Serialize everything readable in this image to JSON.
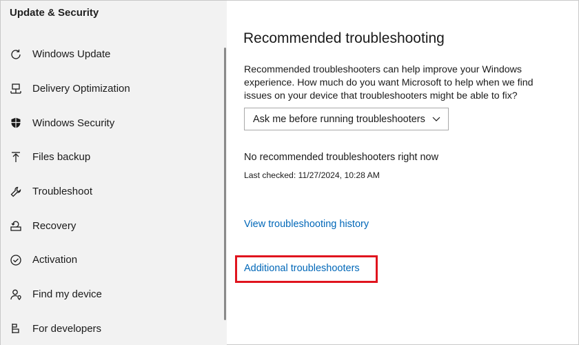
{
  "section_title": "Update & Security",
  "sidebar": {
    "items": [
      {
        "label": "Windows Update",
        "icon": "refresh-icon"
      },
      {
        "label": "Delivery Optimization",
        "icon": "delivery-optimization-icon"
      },
      {
        "label": "Windows Security",
        "icon": "shield-icon"
      },
      {
        "label": "Files backup",
        "icon": "upload-arrow-icon"
      },
      {
        "label": "Troubleshoot",
        "icon": "wrench-icon"
      },
      {
        "label": "Recovery",
        "icon": "recovery-icon"
      },
      {
        "label": "Activation",
        "icon": "check-circle-icon"
      },
      {
        "label": "Find my device",
        "icon": "person-location-icon"
      },
      {
        "label": "For developers",
        "icon": "developer-icon"
      }
    ]
  },
  "main": {
    "title": "Recommended troubleshooting",
    "description": "Recommended troubleshooters can help improve your Windows experience. How much do you want Microsoft to help when we find issues on your device that troubleshooters might be able to fix?",
    "dropdown_value": "Ask me before running troubleshooters",
    "status": "No recommended troubleshooters right now",
    "last_checked": "Last checked: 11/27/2024, 10:28 AM",
    "history_link": "View troubleshooting history",
    "additional_link": "Additional troubleshooters"
  },
  "colors": {
    "link": "#0067b8",
    "highlight": "#e0141e",
    "sidebar_bg": "#f2f2f2"
  }
}
